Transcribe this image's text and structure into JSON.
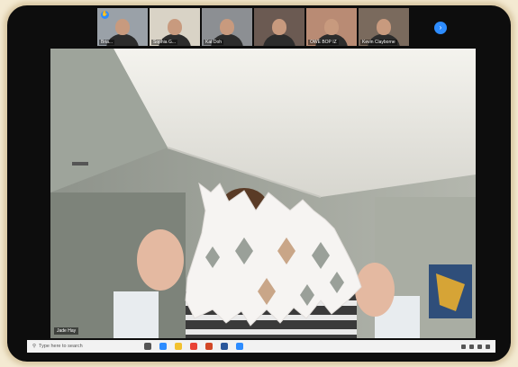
{
  "meeting": {
    "raise_hand_label": "✋",
    "more_label": "›"
  },
  "participants": [
    {
      "name": "Bria...",
      "bg": "#9aa1a8"
    },
    {
      "name": "Sophia G...",
      "bg": "#d9d3c6"
    },
    {
      "name": "Kat Doh",
      "bg": "#8c8f93"
    },
    {
      "name": "",
      "bg": "#6b5a52"
    },
    {
      "name": "OWE BOP IZ",
      "bg": "#b98b74"
    },
    {
      "name": "Kevin Clayborne",
      "bg": "#7a6a5d"
    }
  ],
  "main_video": {
    "speaker_name": "Jade Hay"
  },
  "taskbar": {
    "search_placeholder": "Type here to search",
    "apps": [
      {
        "icon": "task-view-icon",
        "color": "#555555"
      },
      {
        "icon": "edge-icon",
        "color": "#2d8cff"
      },
      {
        "icon": "file-explorer-icon",
        "color": "#f2c12e"
      },
      {
        "icon": "chrome-icon",
        "color": "#e94235"
      },
      {
        "icon": "powerpoint-icon",
        "color": "#d24726"
      },
      {
        "icon": "word-icon",
        "color": "#2b579a"
      },
      {
        "icon": "zoom-icon",
        "color": "#2d8cff"
      }
    ]
  }
}
